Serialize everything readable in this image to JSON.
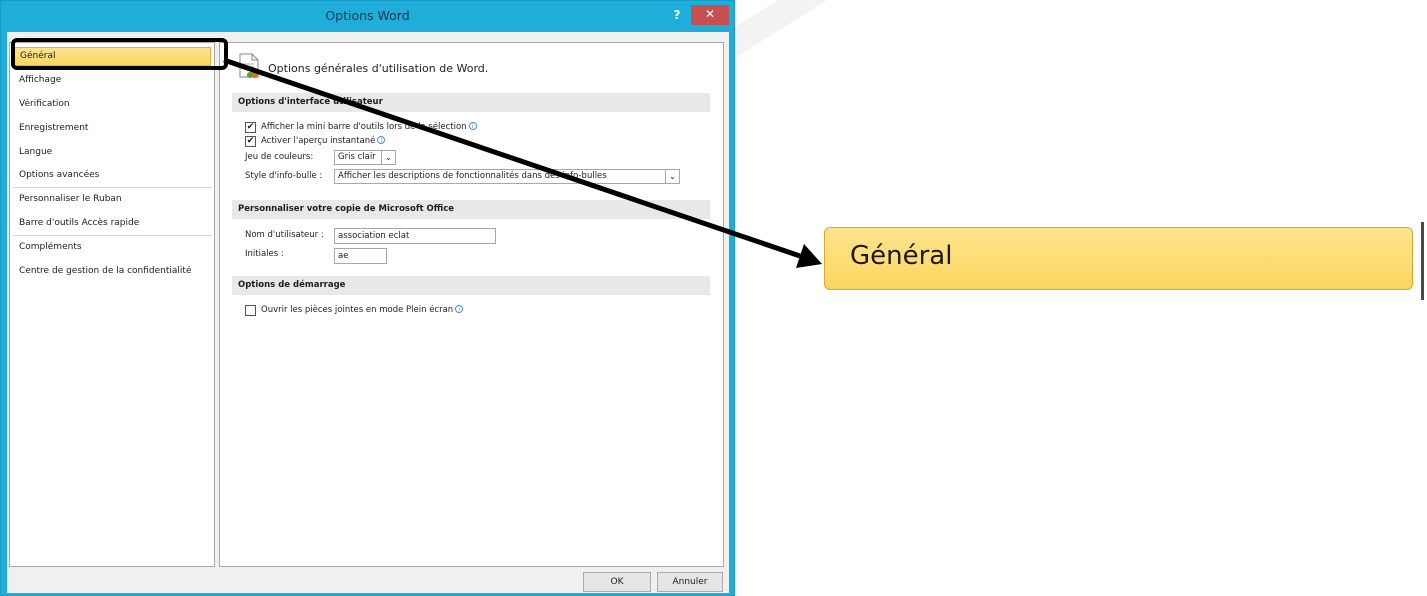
{
  "window": {
    "title": "Options Word",
    "help_label": "?",
    "close_label": "✕"
  },
  "sidebar": {
    "items": [
      {
        "label": "Général",
        "selected": true
      },
      {
        "label": "Affichage"
      },
      {
        "label": "Vérification"
      },
      {
        "label": "Enregistrement"
      },
      {
        "label": "Langue"
      },
      {
        "label": "Options avancées"
      },
      {
        "label": "Personnaliser le Ruban"
      },
      {
        "label": "Barre d'outils Accès rapide"
      },
      {
        "label": "Compléments"
      },
      {
        "label": "Centre de gestion de la confidentialité"
      }
    ]
  },
  "content": {
    "header_title": "Options générales d'utilisation de Word.",
    "sections": {
      "ui": "Options d'interface utilisateur",
      "personalize": "Personnaliser votre copie de Microsoft Office",
      "startup": "Options de démarrage"
    },
    "mini_toolbar": {
      "label": "Afficher la mini barre d'outils lors de la sélection",
      "checked": true
    },
    "live_preview": {
      "label": "Activer l'aperçu instantané",
      "checked": true
    },
    "color_scheme": {
      "label": "Jeu de couleurs:",
      "value": "Gris clair"
    },
    "tooltip_style": {
      "label": "Style d'info-bulle :",
      "value": "Afficher les descriptions de fonctionnalités dans des info-bulles"
    },
    "username": {
      "label": "Nom d'utilisateur :",
      "value": "association eclat"
    },
    "initials": {
      "label": "Initiales :",
      "value": "ae"
    },
    "open_attachments": {
      "label": "Ouvrir les pièces jointes en mode Plein écran",
      "checked": false
    }
  },
  "footer": {
    "ok_label": "OK",
    "cancel_label": "Annuler"
  },
  "callout": {
    "zoom_label": "Général"
  },
  "icons": {
    "check": "✔",
    "info": "i",
    "dropdown": "⌄"
  },
  "colors": {
    "title_bar": "#1faed9",
    "close_button": "#c75050",
    "selection": "#fbd660"
  }
}
